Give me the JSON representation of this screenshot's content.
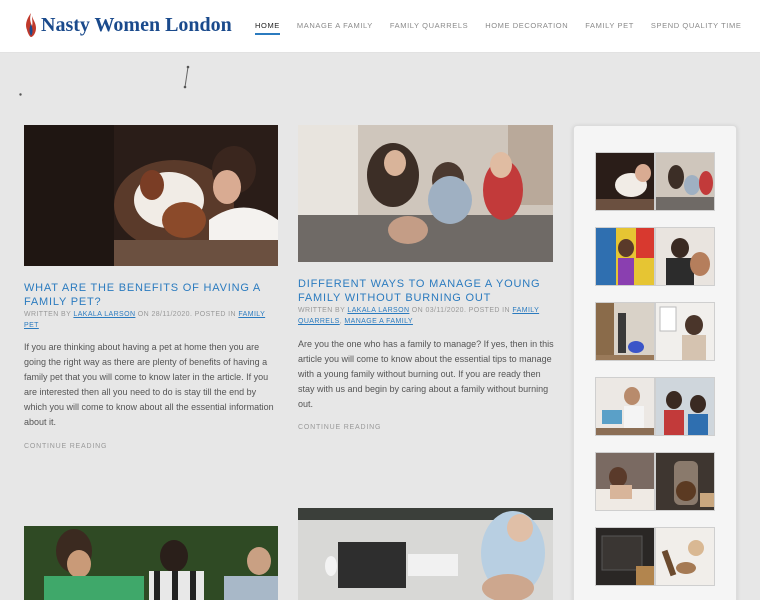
{
  "site": {
    "title": "Nasty Women London"
  },
  "nav": {
    "items": [
      "Home",
      "Manage A Family",
      "Family Quarrels",
      "Home Decoration",
      "Family Pet",
      "Spend Quality Time"
    ]
  },
  "posts": [
    {
      "title": "What Are The Benefits Of Having A Family Pet?",
      "meta_written_by": "Written by",
      "author": "Lakala Larson",
      "meta_on": "on",
      "date": "28/11/2020",
      "meta_posted_in": ". Posted in",
      "category": "Family Pet",
      "excerpt": "If you are thinking about having a pet at home then you are going the right way as there are plenty of benefits of having a family pet that you will come to know later in the article. If you are interested then all you need to do is stay till the end by which you will come to know about all the essential information about it.",
      "continue": "Continue Reading"
    },
    {
      "title": "Different Ways To Manage A Young Family Without Burning Out",
      "meta_written_by": "Written by",
      "author": "Lakala Larson",
      "meta_on": "on",
      "date": "03/11/2020",
      "meta_posted_in": ". Posted in",
      "category": "Family Quarrels",
      "category2": "Manage A Family",
      "excerpt": "Are you the one who has a family to manage? If yes, then in this article you will come to know about the essential tips to manage with a young family without burning out. If you are ready then stay with us and begin by caring about a family without burning out.",
      "continue": "Continue Reading"
    }
  ],
  "colors": {
    "accent": "#2b7bbf",
    "title": "#1a4a8c",
    "background": "#e7e7e7"
  }
}
